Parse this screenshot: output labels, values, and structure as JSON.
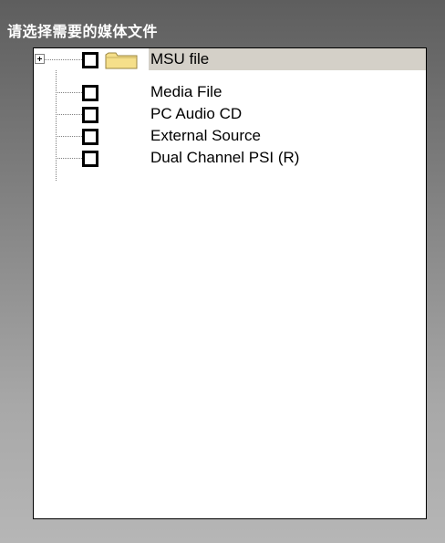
{
  "panel": {
    "title": "请选择需要的媒体文件"
  },
  "tree": {
    "items": [
      {
        "label": "MSU file",
        "checked": false,
        "expandable": true,
        "expanded": false,
        "icon": "folder-icon",
        "selected": true
      },
      {
        "label": "Media File",
        "checked": false,
        "expandable": false,
        "selected": false
      },
      {
        "label": "PC Audio CD",
        "checked": false,
        "expandable": false,
        "selected": false
      },
      {
        "label": "External Source",
        "checked": false,
        "expandable": false,
        "selected": false
      },
      {
        "label": "Dual Channel PSI (R)",
        "checked": false,
        "expandable": false,
        "selected": false
      }
    ]
  },
  "colors": {
    "selection": "#d4d0c8",
    "folder": "#f5df8a",
    "tree_lines": "#808080"
  }
}
